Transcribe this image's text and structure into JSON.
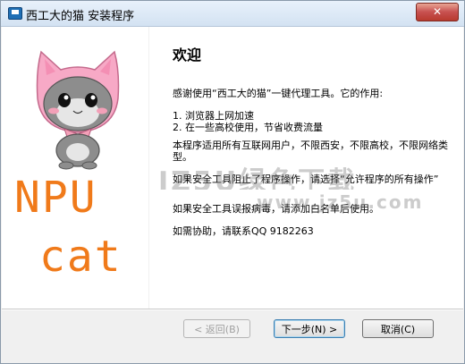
{
  "window": {
    "title": "西工大的猫 安装程序",
    "close_label": "✕"
  },
  "side": {
    "npu": "NPU",
    "cat": "cat"
  },
  "content": {
    "heading": "欢迎",
    "intro": "感谢使用“西工大的猫”一键代理工具。它的作用:",
    "item1": "1. 浏览器上网加速",
    "item2": "2. 在一些高校使用，节省收费流量",
    "scope": "本程序适用所有互联网用户，不限西安，不限高校，不限网络类型。",
    "block": "如果安全工具阻止了程序操作，请选择“允许程序的所有操作”",
    "virus": "如果安全工具误报病毒，请添加白名单后使用。",
    "help": "如需协助，请联系QQ 9182263"
  },
  "watermark": {
    "big": "JZ5U绿色下载",
    "url": "www.jz5u.com"
  },
  "buttons": {
    "back": "< 返回(B)",
    "next": "下一步(N) >",
    "cancel": "取消(C)"
  },
  "colors": {
    "accent_orange": "#f07a1a",
    "cat_pink": "#f7a9c6"
  }
}
